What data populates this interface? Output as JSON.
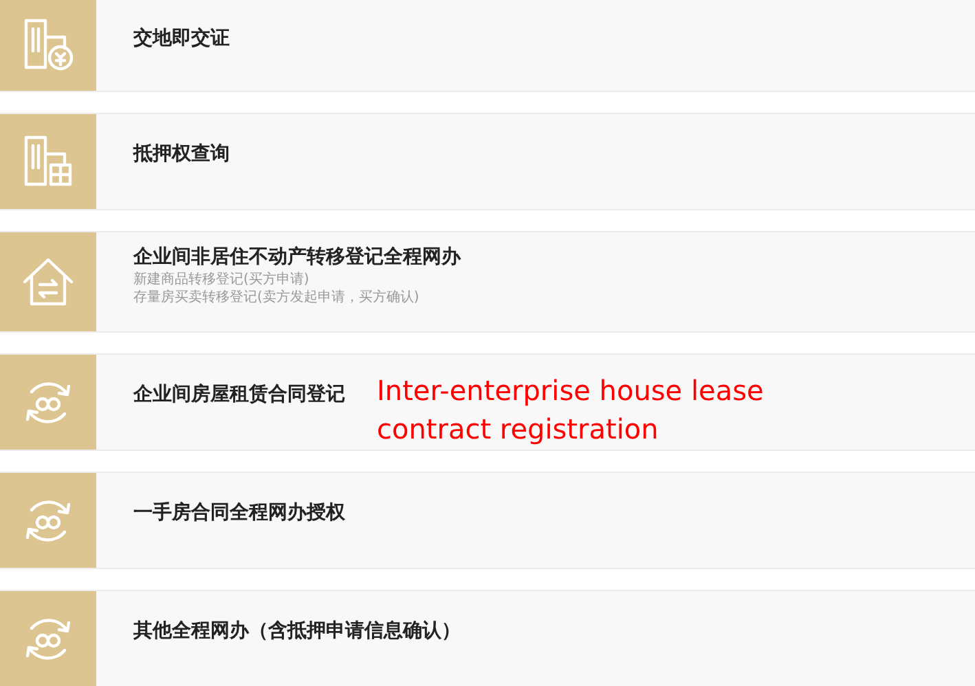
{
  "items": [
    {
      "kind": "building-coin",
      "title": "交地即交证"
    },
    {
      "kind": "building-grid",
      "title": "抵押权查询"
    },
    {
      "kind": "house-swap",
      "title": "企业间非居住不动产转移登记全程网办",
      "subtitles": [
        "新建商品转移登记(买方申请)",
        "存量房买卖转移登记(卖方发起申请，买方确认)"
      ]
    },
    {
      "kind": "cycle",
      "title": "企业间房屋租赁合同登记",
      "annotation": [
        "Inter-enterprise house lease",
        "contract registration"
      ]
    },
    {
      "kind": "cycle",
      "title": "一手房合同全程网办授权"
    },
    {
      "kind": "cycle",
      "title": "其他全程网办（含抵押申请信息确认）"
    }
  ]
}
